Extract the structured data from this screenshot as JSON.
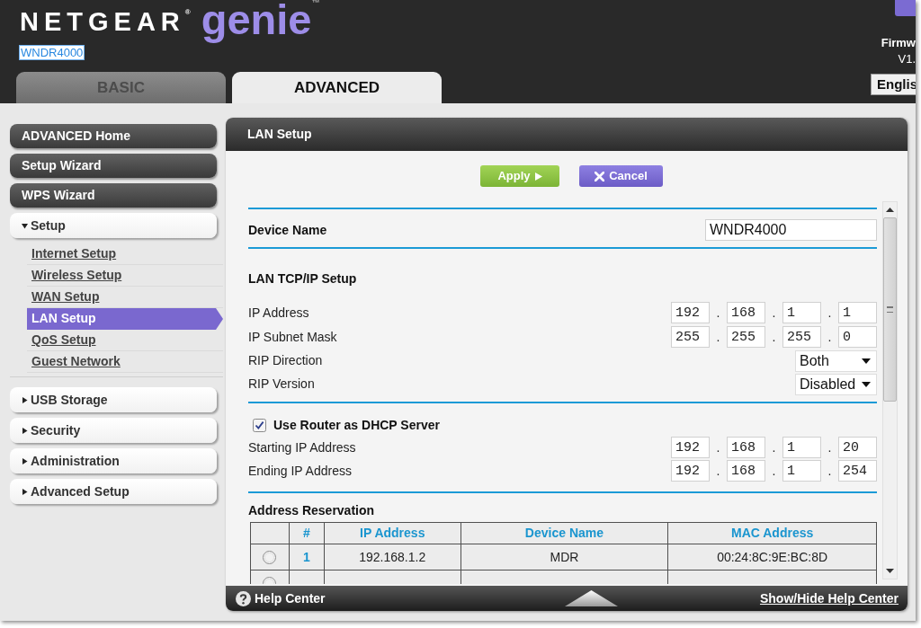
{
  "header": {
    "brand": "NETGEAR$^{®}$",
    "product": "genie$^{™}$",
    "model": "WNDR4000",
    "firmware_label": "Firmw",
    "firmware_version": "V1.",
    "language": "Englis"
  },
  "tabs": [
    {
      "label": "BASIC",
      "selected": false
    },
    {
      "label": "ADVANCED",
      "selected": true
    }
  ],
  "sidebar": {
    "items": [
      {
        "kind": "link",
        "label": "ADVANCED Home"
      },
      {
        "kind": "link",
        "label": "Setup Wizard"
      },
      {
        "kind": "link",
        "label": "WPS Wizard"
      },
      {
        "kind": "group",
        "label": "Setup",
        "expanded": true,
        "children": [
          {
            "label": "Internet Setup",
            "selected": false
          },
          {
            "label": "Wireless Setup",
            "selected": false
          },
          {
            "label": "WAN Setup",
            "selected": false
          },
          {
            "label": "LAN Setup",
            "selected": true
          },
          {
            "label": "QoS Setup",
            "selected": false
          },
          {
            "label": "Guest Network",
            "selected": false
          }
        ]
      },
      {
        "kind": "group",
        "label": "USB Storage",
        "expanded": false
      },
      {
        "kind": "group",
        "label": "Security",
        "expanded": false
      },
      {
        "kind": "group",
        "label": "Administration",
        "expanded": false
      },
      {
        "kind": "group",
        "label": "Advanced Setup",
        "expanded": false
      }
    ]
  },
  "panel": {
    "title": "LAN Setup",
    "actions": [
      {
        "kind": "apply",
        "label": "Apply"
      },
      {
        "kind": "cancel",
        "label": "Cancel"
      }
    ],
    "device_name": {
      "label": "Device Name",
      "value": "WNDR4000"
    },
    "lan": {
      "title": "LAN TCP/IP Setup",
      "fields": [
        {
          "kind": "ip",
          "label": "IP Address",
          "octets": [
            "192",
            "168",
            "1",
            "1"
          ],
          "separator": "."
        },
        {
          "kind": "ip",
          "label": "IP Subnet Mask",
          "octets": [
            "255",
            "255",
            "255",
            "0"
          ],
          "separator": "."
        },
        {
          "kind": "select",
          "label": "RIP Direction",
          "value": "Both"
        },
        {
          "kind": "select",
          "label": "RIP Version",
          "value": "Disabled"
        }
      ]
    },
    "dhcp": {
      "label": "Use Router as DHCP Server",
      "checked": true,
      "fields": [
        {
          "kind": "ip",
          "label": "Starting IP Address",
          "octets": [
            "192",
            "168",
            "1",
            "20"
          ],
          "separator": "."
        },
        {
          "kind": "ip",
          "label": "Ending IP Address",
          "octets": [
            "192",
            "168",
            "1",
            "254"
          ],
          "separator": "."
        }
      ]
    },
    "reservation": {
      "title": "Address Reservation",
      "columns": [
        "#",
        "IP Address",
        "Device Name",
        "MAC Address"
      ],
      "rows": [
        {
          "selected": false,
          "cells": [
            "1",
            "192.168.1.2",
            "MDR",
            "00:24:8C:9E:BC:8D"
          ]
        },
        {
          "selected": false
        }
      ]
    }
  },
  "footer": {
    "help": "Help Center",
    "toggle": "Show/Hide Help Center"
  }
}
